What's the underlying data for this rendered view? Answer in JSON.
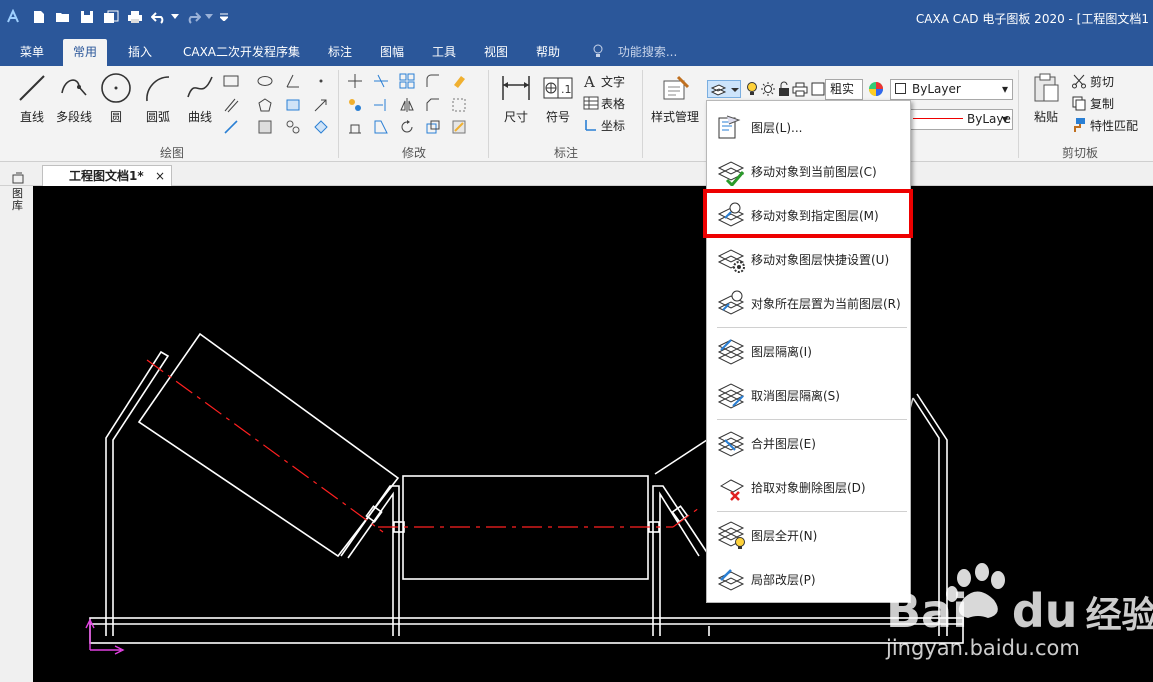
{
  "app": {
    "title": "CAXA CAD 电子图板 2020 - [工程图文档1"
  },
  "ribbon_tabs": [
    {
      "label": "菜单",
      "active": false
    },
    {
      "label": "常用",
      "active": true
    },
    {
      "label": "插入",
      "active": false
    },
    {
      "label": "CAXA二次开发程序集",
      "active": false
    },
    {
      "label": "标注",
      "active": false
    },
    {
      "label": "图幅",
      "active": false
    },
    {
      "label": "工具",
      "active": false
    },
    {
      "label": "视图",
      "active": false
    },
    {
      "label": "帮助",
      "active": false
    }
  ],
  "search": {
    "placeholder": "功能搜索..."
  },
  "draw_group": {
    "label": "绘图",
    "buttons": [
      "直线",
      "多段线",
      "圆",
      "圆弧",
      "曲线"
    ]
  },
  "modify_group": {
    "label": "修改"
  },
  "annot_group": {
    "label": "标注",
    "buttons": [
      "尺寸",
      "符号"
    ],
    "small": [
      "文字",
      "表格",
      "坐标"
    ]
  },
  "style": {
    "label": "样式管理"
  },
  "props": {
    "linewidth_label": "粗实",
    "color_combo": "ByLayer",
    "linetype_combo": "ByLayer"
  },
  "clipboard_group": {
    "label": "剪切板",
    "paste_label": "粘贴",
    "small": [
      "剪切",
      "复制",
      "特性匹配"
    ]
  },
  "doc_tab": {
    "label": "工程图文档1*",
    "close": "×"
  },
  "left_strip": {
    "label": "图库"
  },
  "layer_menu": {
    "items": [
      "图层(L)...",
      "移动对象到当前图层(C)",
      "移动对象到指定图层(M)",
      "移动对象图层快捷设置(U)",
      "对象所在层置为当前图层(R)",
      "图层隔离(I)",
      "取消图层隔离(S)",
      "合并图层(E)",
      "拾取对象删除图层(D)",
      "图层全开(N)",
      "局部改层(P)"
    ],
    "highlighted": "移动对象到指定图层(M)"
  },
  "watermark": {
    "brand": "Bai",
    "brand2": "du",
    "cn": "经验",
    "url": "jingyan.baidu.com"
  },
  "colors": {
    "title_blue": "#2b579a",
    "highlight_red": "#e00000",
    "cad_red": "#ff2020",
    "ucs_magenta": "#e040e0"
  }
}
